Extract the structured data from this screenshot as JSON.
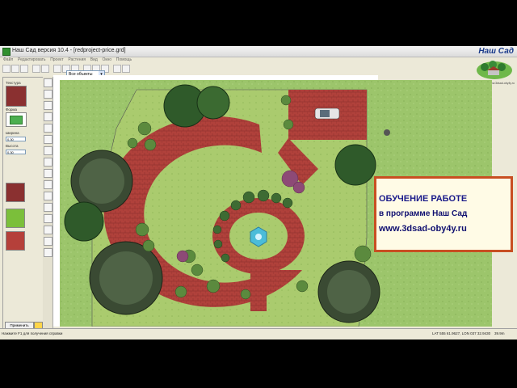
{
  "window": {
    "title": "Наш Сад версия 10.4 - [redproject-price.grd]"
  },
  "logo": {
    "brand": "Наш Сад",
    "tagline": "www.3dsad-oby4y.ru"
  },
  "menu": {
    "items": [
      "Файл",
      "Редактировать",
      "Проект",
      "Растения",
      "Вид",
      "Окно",
      "Помощь"
    ]
  },
  "toolbar": {
    "layer_select": "Все объекты",
    "arrow": "▾"
  },
  "properties": {
    "texture_label": "Текстура",
    "shape_label": "Форма",
    "width_label": "Ширина",
    "width_value": "0.30",
    "height_label": "Высота",
    "height_value": "0.30",
    "apply_button": "Применить",
    "colors": {
      "texture": "#8a3030",
      "shape": "#4caf50",
      "grass": "#7bbf3a",
      "brick": "#b5403a"
    }
  },
  "canvas": {
    "colors": {
      "lawn": "#9cc56b",
      "path": "#b0413b",
      "tree": "#3e5a32",
      "fountain": "#4bbcd9"
    }
  },
  "banner": {
    "line1": "ОБУЧЕНИЕ РАБОТЕ",
    "line2": "в программе Наш Сад",
    "line3": "www.3dsad-oby4y.ru",
    "border_color": "#c84f22",
    "text_color": "#0f0f70"
  },
  "status": {
    "hint": "Нажмите F1 для получения справки",
    "coords": "LAT 555 61.9627, LON 037 32.9430",
    "zoom": "39.9m"
  }
}
